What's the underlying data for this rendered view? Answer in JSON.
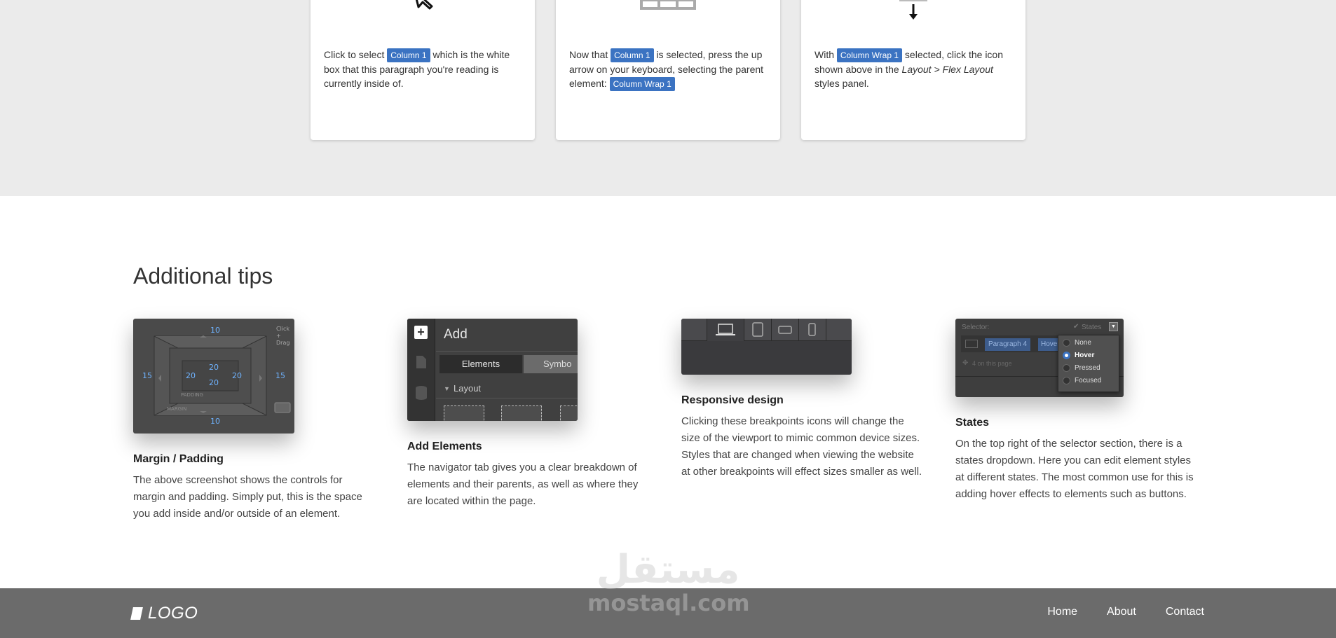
{
  "steps": [
    {
      "before": "Click to select ",
      "tag1": "Column 1",
      "after": " which is the white box that this paragraph you're reading is currently inside of."
    },
    {
      "before": "Now that ",
      "tag1": "Column 1",
      "middle": " is selected, press the up arrow on your keyboard, selecting the parent element: ",
      "tag2": "Column Wrap 1"
    },
    {
      "before": "With ",
      "tag1": "Column Wrap 1",
      "middle": " selected, click the icon shown above in the ",
      "italic": "Layout > Flex Layout",
      "after": " styles panel."
    }
  ],
  "tips": {
    "title": "Additional tips",
    "items": [
      {
        "heading": "Margin / Padding",
        "body": "The above screenshot shows the controls for margin and padding. Simply put, this is the space you add inside and/or outside of an element.",
        "shot": {
          "top": "10",
          "bottom": "10",
          "left": "15",
          "right": "15",
          "pad_top": "20",
          "pad_bottom": "20",
          "pad_left": "20",
          "pad_right": "20",
          "padding_label": "PADDING",
          "margin_label": "MARGIN",
          "hint": "Click + Drag"
        }
      },
      {
        "heading": "Add Elements",
        "body": "The navigator tab gives you a clear breakdown of elements and their parents, as well as where they are located within the page.",
        "shot": {
          "panel_title": "Add",
          "tab_elements": "Elements",
          "tab_symbols": "Symbo",
          "section": "Layout"
        }
      },
      {
        "heading": "Responsive design",
        "body": "Clicking these breakpoints icons will change the size of the viewport to mimic common device sizes. Styles that are changed when viewing the website at other breakpoints will effect sizes smaller as well."
      },
      {
        "heading": "States",
        "body": "On the top right of the selector section, there is a states dropdown. Here you can edit element styles at different states. The most common use for this is adding hover effects to elements such as buttons.",
        "shot": {
          "selector_label": "Selector:",
          "states_label": "States",
          "chip1": "Paragraph 4",
          "chip2": "Hove",
          "on_page": "4 on this page",
          "options": [
            "None",
            "Hover",
            "Pressed",
            "Focused"
          ],
          "selected": "Hover"
        }
      }
    ]
  },
  "footer": {
    "logo": "LOGO",
    "nav": [
      "Home",
      "About",
      "Contact"
    ]
  },
  "watermark": {
    "arabic": "مستقل",
    "latin": "mostaql.com"
  }
}
